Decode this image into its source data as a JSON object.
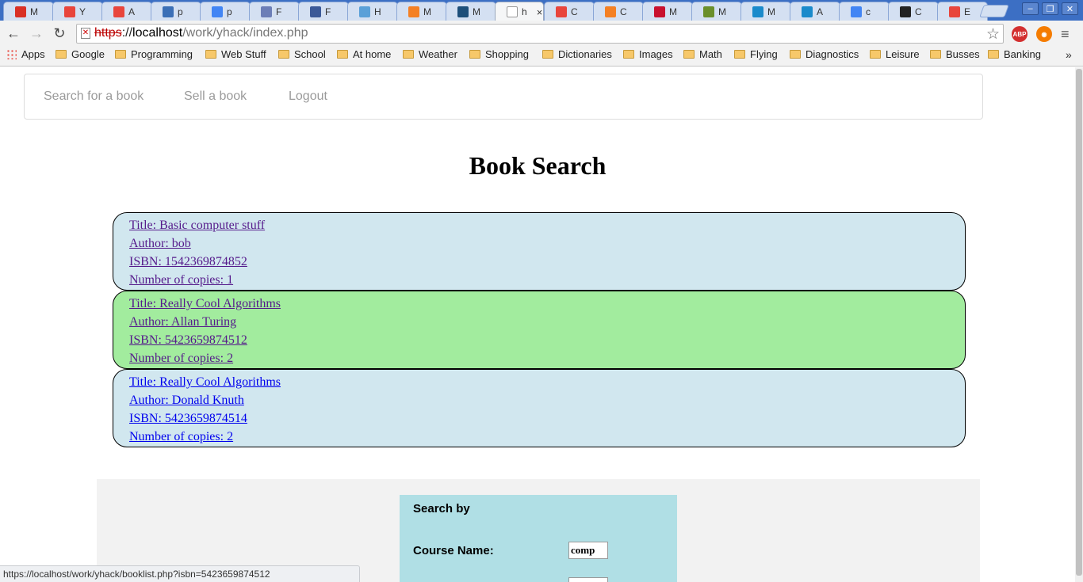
{
  "browser": {
    "tabs": [
      {
        "label": "M",
        "icon": "gmail-icon",
        "color": "#d93025"
      },
      {
        "label": "Y",
        "icon": "pinwheel-icon",
        "color": "#e8453c"
      },
      {
        "label": "A",
        "icon": "pinwheel-icon",
        "color": "#e8453c"
      },
      {
        "label": "p",
        "icon": "globe-icon",
        "color": "#3b6fb6"
      },
      {
        "label": "p",
        "icon": "google-icon",
        "color": "#4285f4"
      },
      {
        "label": "F",
        "icon": "php-icon",
        "color": "#6c7eb7"
      },
      {
        "label": "F",
        "icon": "facebook-icon",
        "color": "#3b5998"
      },
      {
        "label": "H",
        "icon": "cloud-icon",
        "color": "#5aa0d8"
      },
      {
        "label": "M",
        "icon": "stack-icon",
        "color": "#f48024"
      },
      {
        "label": "M",
        "icon": "photo-icon",
        "color": "#1d4f7a"
      },
      {
        "label": "h",
        "icon": "page-icon",
        "color": "#ffffff"
      },
      {
        "label": "C",
        "icon": "pinwheel-icon",
        "color": "#e8453c"
      },
      {
        "label": "C",
        "icon": "stack-icon",
        "color": "#f48024"
      },
      {
        "label": "M",
        "icon": "flag-icon",
        "color": "#c8102e"
      },
      {
        "label": "M",
        "icon": "map-icon",
        "color": "#6a8f2b"
      },
      {
        "label": "M",
        "icon": "c-icon",
        "color": "#1a8acb"
      },
      {
        "label": "A",
        "icon": "c-icon",
        "color": "#1a8acb"
      },
      {
        "label": "c",
        "icon": "google-icon",
        "color": "#4285f4"
      },
      {
        "label": "C",
        "icon": "github-icon",
        "color": "#222222"
      },
      {
        "label": "E",
        "icon": "pinwheel-icon",
        "color": "#e8453c"
      }
    ],
    "active_tab_index": 10,
    "url": {
      "scheme": "https",
      "sep": "://",
      "host": "localhost",
      "path": "/work/yhack/index.php"
    },
    "bookmarks": [
      "Apps",
      "Google",
      "Programming",
      "Web Stuff",
      "School",
      "At home",
      "Weather",
      "Shopping",
      "Dictionaries",
      "Images",
      "Math",
      "Flying",
      "Diagnostics",
      "Leisure",
      "Busses",
      "Banking"
    ],
    "bookmarks_overflow": "»",
    "status_url": "https://localhost/work/yhack/booklist.php?isbn=5423659874512"
  },
  "nav": {
    "search": "Search for a book",
    "sell": "Sell a book",
    "logout": "Logout"
  },
  "page": {
    "heading": "Book Search"
  },
  "books": [
    {
      "title": "Title: Basic computer stuff",
      "author": "Author: bob",
      "isbn": "ISBN: 1542369874852",
      "copies": "Number of copies: 1",
      "bg": "#d1e7ef",
      "visited": true
    },
    {
      "title": "Title: Really Cool Algorithms",
      "author": "Author: Allan Turing",
      "isbn": "ISBN: 5423659874512",
      "copies": "Number of copies: 2",
      "bg": "#a2ec9e",
      "visited": true
    },
    {
      "title": "Title: Really Cool Algorithms",
      "author": "Author: Donald Knuth",
      "isbn": "ISBN: 5423659874514",
      "copies": "Number of copies: 2",
      "bg": "#d1e7ef",
      "visited": false
    }
  ],
  "search_form": {
    "heading": "Search by",
    "course_label": "Course Name:",
    "course_value": "comp"
  }
}
